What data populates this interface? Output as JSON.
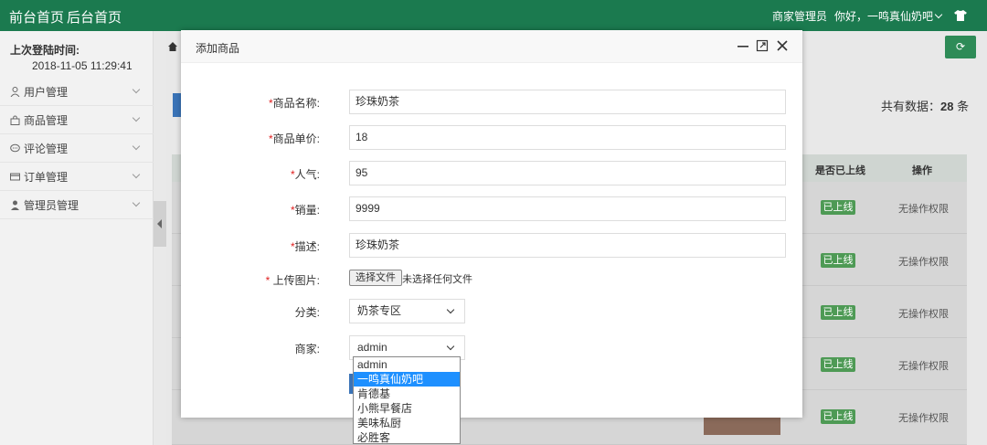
{
  "topbar": {
    "nav_front": "前台首页",
    "nav_back": "后台首页",
    "role": "商家管理员",
    "greeting": "你好，一鸣真仙奶吧"
  },
  "sidebar": {
    "last_login_label": "上次登陆时间:",
    "last_login_time": "2018-11-05 11:29:41",
    "items": [
      {
        "label": "用户管理"
      },
      {
        "label": "商品管理"
      },
      {
        "label": "评论管理"
      },
      {
        "label": "订单管理"
      },
      {
        "label": "管理员管理"
      }
    ]
  },
  "list": {
    "total_prefix": "共有数据：",
    "total_count": "28",
    "total_suffix": " 条",
    "col_online": "是否已上线",
    "col_action": "操作",
    "badge": "已上线",
    "no_permission": "无操作权限"
  },
  "modal": {
    "title": "添加商品",
    "fields": {
      "name_label": "商品名称:",
      "name_value": "珍珠奶茶",
      "price_label": "商品单价:",
      "price_value": "18",
      "popularity_label": "人气:",
      "popularity_value": "95",
      "sales_label": "销量:",
      "sales_value": "9999",
      "desc_label": "描述:",
      "desc_value": "珍珠奶茶",
      "upload_label": " 上传图片:",
      "file_button": "选择文件",
      "file_status": "未选择任何文件",
      "category_label": "分类:",
      "category_value": "奶茶专区",
      "merchant_label": "商家:",
      "merchant_value": "admin"
    },
    "merchant_options": [
      "admin",
      "一鸣真仙奶吧",
      "肯德基",
      "小熊早餐店",
      "美味私厨",
      "必胜客"
    ],
    "merchant_highlighted": "一鸣真仙奶吧"
  }
}
